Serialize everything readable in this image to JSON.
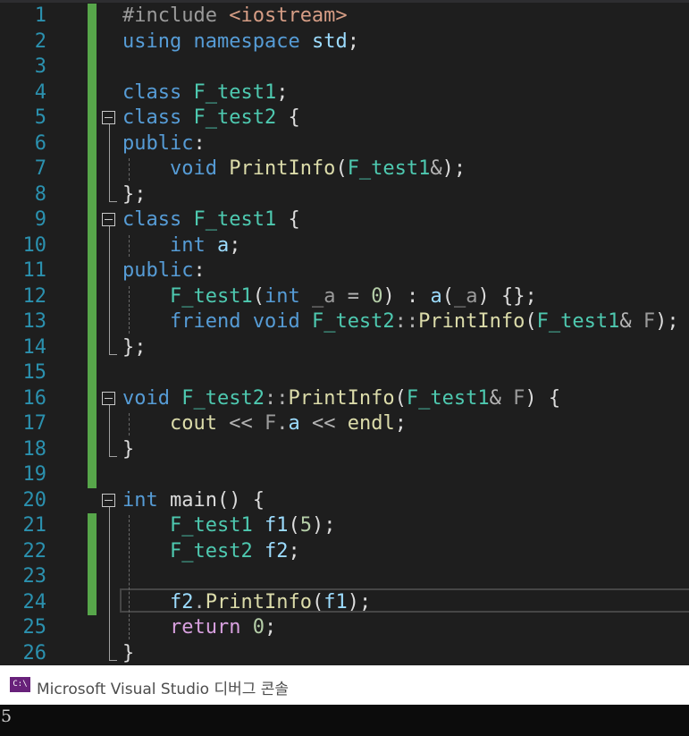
{
  "editor": {
    "lines": [
      {
        "num": "1",
        "text": "#include <iostream>"
      },
      {
        "num": "2",
        "text": "using namespace std;"
      },
      {
        "num": "3",
        "text": ""
      },
      {
        "num": "4",
        "text": "class F_test1;"
      },
      {
        "num": "5",
        "text": "class F_test2 {"
      },
      {
        "num": "6",
        "text": "public:"
      },
      {
        "num": "7",
        "text": "    void PrintInfo(F_test1&);"
      },
      {
        "num": "8",
        "text": "};"
      },
      {
        "num": "9",
        "text": "class F_test1 {"
      },
      {
        "num": "10",
        "text": "    int a;"
      },
      {
        "num": "11",
        "text": "public:"
      },
      {
        "num": "12",
        "text": "    F_test1(int _a = 0) : a(_a) {};"
      },
      {
        "num": "13",
        "text": "    friend void F_test2::PrintInfo(F_test1& F);"
      },
      {
        "num": "14",
        "text": "};"
      },
      {
        "num": "15",
        "text": ""
      },
      {
        "num": "16",
        "text": "void F_test2::PrintInfo(F_test1& F) {"
      },
      {
        "num": "17",
        "text": "    cout << F.a << endl;"
      },
      {
        "num": "18",
        "text": "}"
      },
      {
        "num": "19",
        "text": ""
      },
      {
        "num": "20",
        "text": "int main() {"
      },
      {
        "num": "21",
        "text": "    F_test1 f1(5);"
      },
      {
        "num": "22",
        "text": "    F_test2 f2;"
      },
      {
        "num": "23",
        "text": ""
      },
      {
        "num": "24",
        "text": "    f2.PrintInfo(f1);"
      },
      {
        "num": "25",
        "text": "    return 0;"
      },
      {
        "num": "26",
        "text": "}"
      }
    ]
  },
  "colors": {
    "keyword": "#569cd6",
    "type": "#4ec9b0",
    "function": "#dcdcaa",
    "string": "#d69d85",
    "number": "#b5cea8",
    "control": "#d8a0df",
    "line_number": "#2b91af",
    "change_bar": "#57a64a",
    "background": "#1e1e1e"
  },
  "console": {
    "icon_text": "C:\\",
    "icon": "console-app-icon",
    "title": "Microsoft Visual Studio 디버그 콘솔",
    "output": "5"
  }
}
